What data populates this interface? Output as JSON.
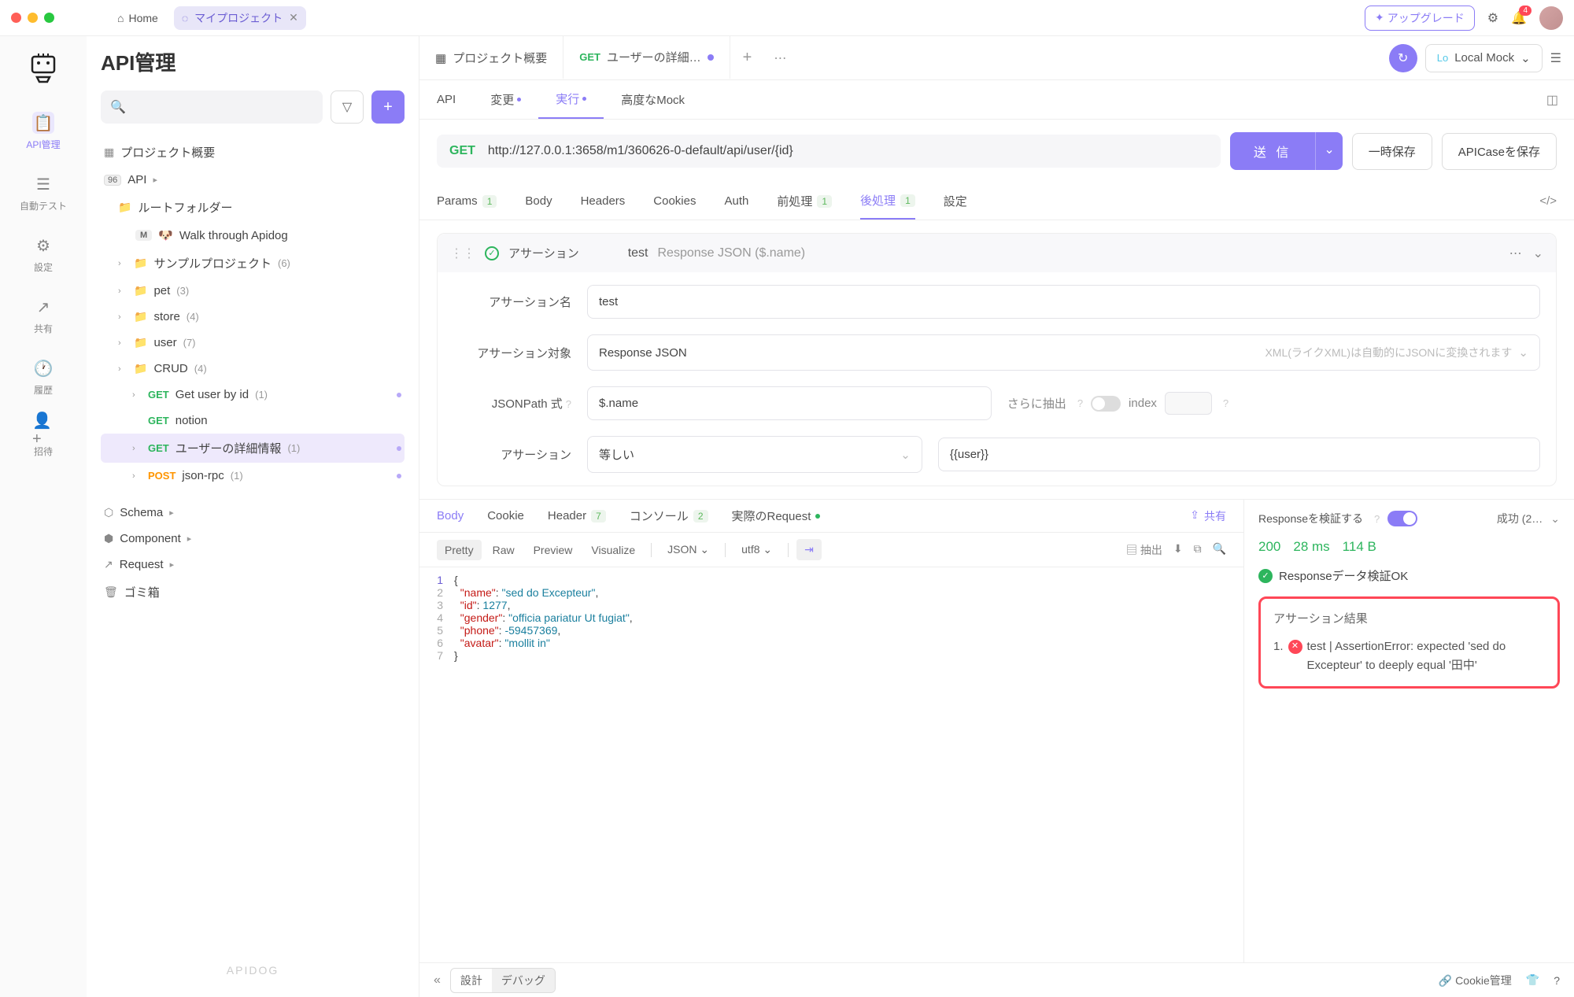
{
  "titlebar": {
    "home": "Home",
    "project_tab": "マイプロジェクト",
    "upgrade": "アップグレード",
    "notif_count": "4"
  },
  "leftnav": {
    "items": [
      {
        "label": "API管理",
        "active": true
      },
      {
        "label": "自動テスト"
      },
      {
        "label": "設定"
      },
      {
        "label": "共有"
      },
      {
        "label": "履歴"
      },
      {
        "label": "招待"
      }
    ]
  },
  "sidebar": {
    "title": "API管理",
    "project_overview": "プロジェクト概要",
    "api_root": "API",
    "root_folder": "ルートフォルダー",
    "walkthrough": "Walk through Apidog",
    "folders": [
      {
        "name": "サンプルプロジェクト",
        "count": "(6)"
      },
      {
        "name": "pet",
        "count": "(3)"
      },
      {
        "name": "store",
        "count": "(4)"
      },
      {
        "name": "user",
        "count": "(7)"
      },
      {
        "name": "CRUD",
        "count": "(4)"
      }
    ],
    "endpoints": [
      {
        "method": "GET",
        "name": "Get user by id",
        "count": "(1)"
      },
      {
        "method": "GET",
        "name": "notion"
      },
      {
        "method": "GET",
        "name": "ユーザーの詳細情報",
        "count": "(1)",
        "selected": true
      },
      {
        "method": "POST",
        "name": "json-rpc",
        "count": "(1)"
      }
    ],
    "sections": {
      "schema": "Schema",
      "component": "Component",
      "request": "Request",
      "trash": "ゴミ箱"
    },
    "footer": "APIDOG"
  },
  "tabs": {
    "overview": "プロジェクト概要",
    "active": {
      "method": "GET",
      "name": "ユーザーの詳細…"
    },
    "env_lo": "Lo",
    "env_name": "Local Mock"
  },
  "subtabs": {
    "api": "API",
    "modify": "変更",
    "run": "実行",
    "advanced_mock": "高度なMock"
  },
  "url": {
    "method": "GET",
    "text": "http://127.0.0.1:3658/m1/360626-0-default/api/user/{id}",
    "send": "送 信",
    "tmpsave": "一時保存",
    "apicase": "APICaseを保存"
  },
  "reqtabs": {
    "params": "Params",
    "params_badge": "1",
    "body": "Body",
    "headers": "Headers",
    "cookies": "Cookies",
    "auth": "Auth",
    "pre": "前処理",
    "pre_badge": "1",
    "post": "後処理",
    "post_badge": "1",
    "settings": "設定"
  },
  "assertion": {
    "title": "アサーション",
    "name_val": "test",
    "detail": "Response JSON ($.name)",
    "name_label": "アサーション名",
    "name_input": "test",
    "target_label": "アサーション対象",
    "target_value": "Response JSON",
    "target_hint": "XML(ライクXML)は自動的にJSONに変換されます",
    "jsonpath_label": "JSONPath 式",
    "jsonpath_value": "$.name",
    "extract_label": "さらに抽出",
    "index_label": "index",
    "assertion_label": "アサーション",
    "op_value": "等しい",
    "val_value": "{{user}}"
  },
  "response": {
    "tabs": {
      "body": "Body",
      "cookie": "Cookie",
      "header": "Header",
      "header_badge": "7",
      "console": "コンソール",
      "console_badge": "2",
      "actual": "実際のRequest"
    },
    "share": "共有",
    "toolbar": {
      "pretty": "Pretty",
      "raw": "Raw",
      "preview": "Preview",
      "visualize": "Visualize",
      "json": "JSON",
      "utf8": "utf8",
      "extract": "抽出"
    },
    "json": {
      "name": "sed do Excepteur",
      "id": "1277",
      "gender": "officia pariatur Ut fugiat",
      "phone": "-59457369",
      "avatar": "mollit in"
    },
    "right": {
      "validate_label": "Responseを検証する",
      "success": "成功 (2…",
      "status": "200",
      "time": "28 ms",
      "size": "114 B",
      "data_ok": "Responseデータ検証OK",
      "assertion_title": "アサーション結果",
      "assertion_error": "test | AssertionError: expected 'sed do Excepteur' to deeply equal '田中'"
    }
  },
  "bottombar": {
    "design": "設計",
    "debug": "デバッグ",
    "cookie": "Cookie管理"
  }
}
